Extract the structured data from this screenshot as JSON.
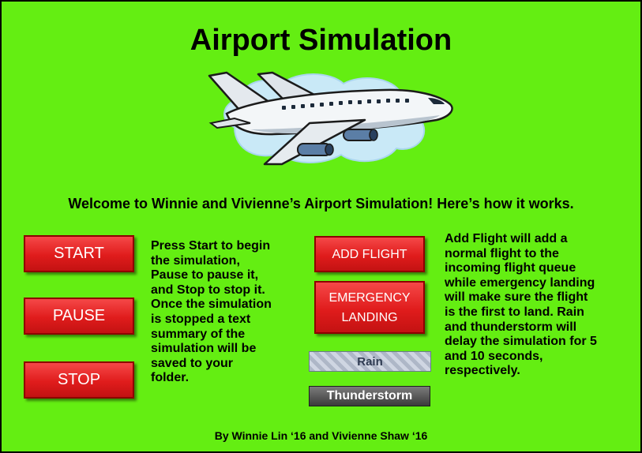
{
  "title": "Airport Simulation",
  "welcome": "Welcome to Winnie and Vivienne’s Airport Simulation! Here’s how it works.",
  "buttons": {
    "start": "START",
    "pause": "PAUSE",
    "stop": "STOP",
    "add_flight": "ADD FLIGHT",
    "emergency_landing": "EMERGENCY\nLANDING",
    "rain": "Rain",
    "thunderstorm": "Thunderstorm"
  },
  "left_description": "Press Start to begin\nthe simulation,\nPause to pause it,\nand Stop to stop it.\nOnce the simulation\nis stopped a text\nsummary of the\nsimulation will be\nsaved to your\nfolder.",
  "right_description": "Add Flight will add a\nnormal flight to the\nincoming flight queue\nwhile emergency landing\nwill make sure the flight\nis the first to land. Rain\nand thunderstorm will\ndelay the simulation for 5\nand 10 seconds,\nrespectively.",
  "footer": "By Winnie Lin ‘16 and Vivienne Shaw ‘16",
  "colors": {
    "background": "#64ee12",
    "button_red": "#e01c1c",
    "sky_cloud": "#bfe3f5"
  },
  "icons": {
    "illustration": "airplane-icon"
  }
}
